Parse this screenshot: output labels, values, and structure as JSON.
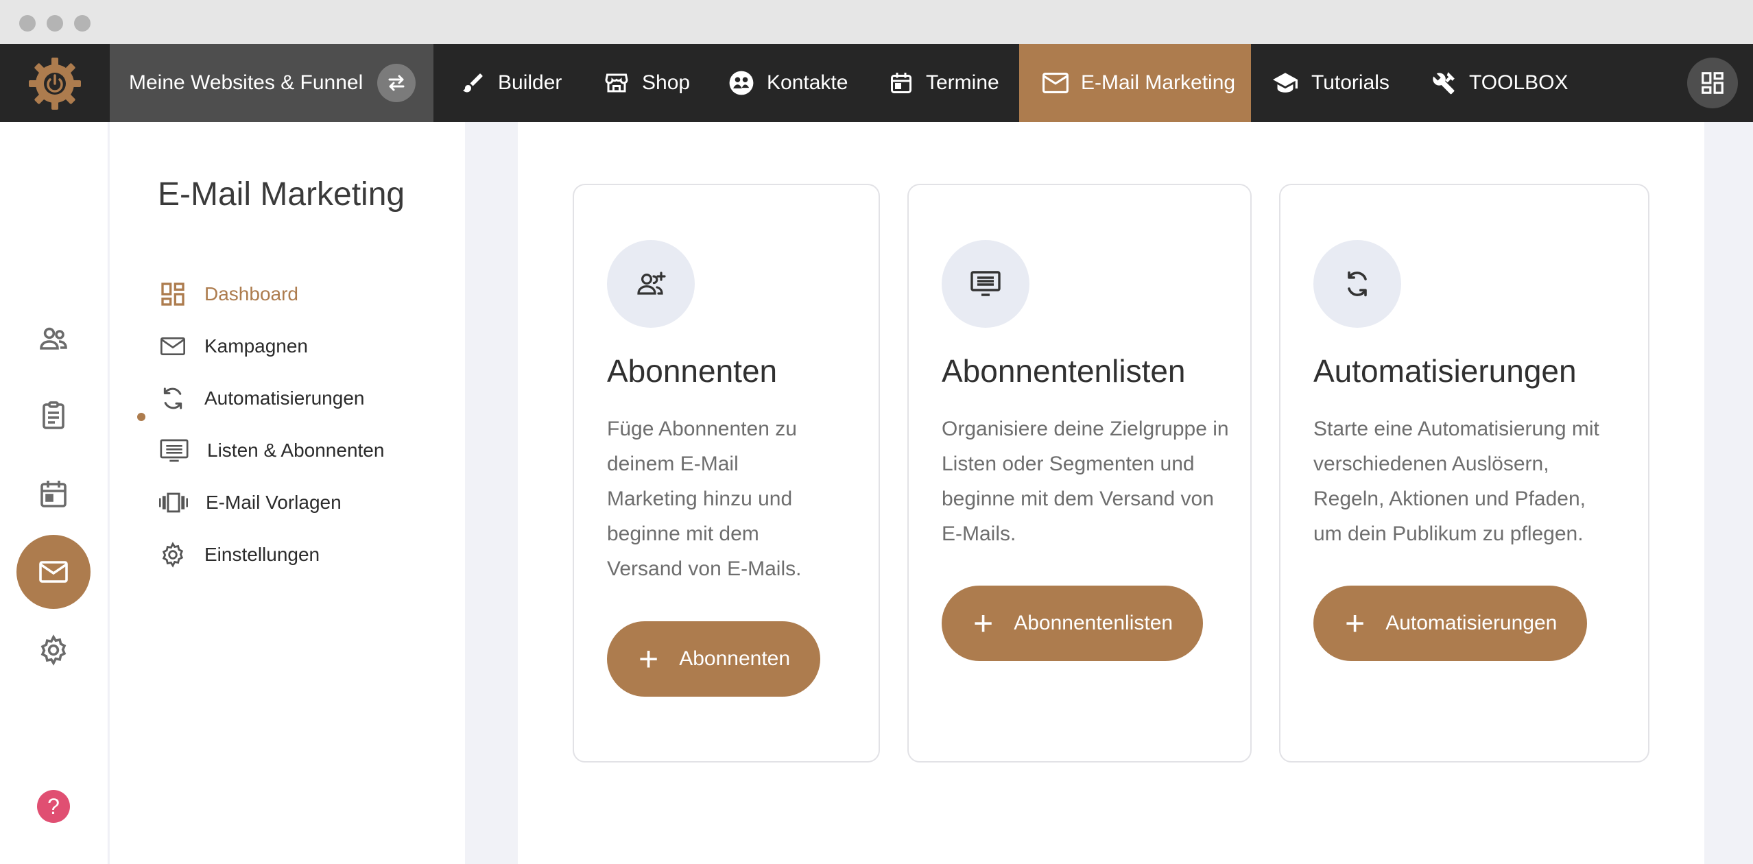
{
  "colors": {
    "accent": "#ad7c4e",
    "topbar": "#262626",
    "help": "#e04f72"
  },
  "topnav": {
    "site_switch_label": "Meine Websites & Funnel",
    "items": [
      {
        "label": "Builder",
        "icon": "brush-icon"
      },
      {
        "label": "Shop",
        "icon": "store-icon"
      },
      {
        "label": "Kontakte",
        "icon": "contacts-icon"
      },
      {
        "label": "Termine",
        "icon": "calendar-icon"
      },
      {
        "label": "E-Mail Marketing",
        "icon": "mail-icon",
        "active": true
      },
      {
        "label": "Tutorials",
        "icon": "graduation-cap-icon"
      },
      {
        "label": "TOOLBOX",
        "icon": "tools-icon"
      }
    ]
  },
  "rail": {
    "help_label": "?"
  },
  "submenu": {
    "title": "E-Mail Marketing",
    "items": [
      {
        "label": "Dashboard",
        "icon": "dashboard-icon",
        "active": true
      },
      {
        "label": "Kampagnen",
        "icon": "mail-icon"
      },
      {
        "label": "Automatisierungen",
        "icon": "sync-icon"
      },
      {
        "label": "Listen & Abonnenten",
        "icon": "list-icon"
      },
      {
        "label": "E-Mail Vorlagen",
        "icon": "carousel-icon"
      },
      {
        "label": "Einstellungen",
        "icon": "gear-icon"
      }
    ]
  },
  "cards": [
    {
      "title": "Abonnenten",
      "icon": "person-add-icon",
      "text": "Füge Abonnenten zu deinem E-Mail Marketing hinzu und beginne mit dem Versand von E-Mails.",
      "button": "Abonnenten"
    },
    {
      "title": "Abonnentenlisten",
      "icon": "list-icon",
      "text": "Organisiere deine Zielgruppe in Listen oder Segmenten und beginne mit dem Versand von E-Mails.",
      "button": "Abonnentenlisten"
    },
    {
      "title": "Automatisierungen",
      "icon": "sync-icon",
      "text": "Starte eine Automatisierung mit verschiedenen Auslösern, Regeln, Aktionen und Pfaden, um dein Publikum zu pflegen.",
      "button": "Automatisierungen"
    }
  ]
}
